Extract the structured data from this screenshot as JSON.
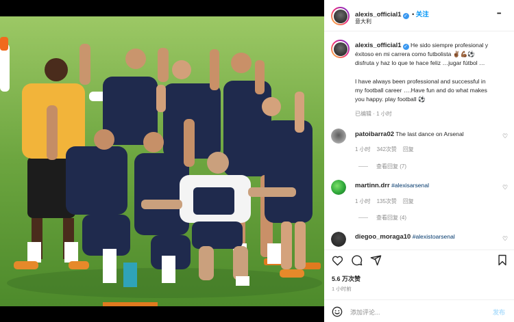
{
  "post": {
    "username": "alexis_official1",
    "follow_label": "关注",
    "location": "意大利",
    "more_label": "•••",
    "caption_user": "alexis_official1",
    "caption_text": "He sido siempre profesional y éxitoso en mi carrera como futbolista ✌🏾💪🏾⚽ disfruta y haz lo que te hace feliz …jugar fútbol … I have always been professional and successful in my football career ….Have fun and do what makes you happy. play football ⚽",
    "caption_line1": "He sido siempre profesional y",
    "caption_line2": "éxitoso en mi carrera como futbolista ✌🏾💪🏾⚽",
    "caption_line3": "disfruta y haz lo que te hace feliz …jugar fútbol …",
    "caption_line4": "I have always been professional and successful in",
    "caption_line5": "my football career ….Have fun and do what makes",
    "caption_line6": "you happy. play football ⚽",
    "edited_label": "已编辑 · 1 小时"
  },
  "comments": [
    {
      "username": "patoibarra02",
      "text": "The last dance on Arsenal",
      "time": "1 小时",
      "likes": "342次赞",
      "reply": "回复",
      "view_replies": "查看回复 (7)"
    },
    {
      "username": "martinn.drr",
      "text": "#alexisarsenal",
      "time": "1 小时",
      "likes": "135次赞",
      "reply": "回复",
      "view_replies": "查看回复 (4)"
    },
    {
      "username": "diegoo_moraga10",
      "text": "#alexistoarsenal"
    }
  ],
  "stats": {
    "likes": "5.6 万次赞",
    "time": "1 小时前"
  },
  "add_comment": {
    "placeholder": "添加评论...",
    "post_label": "发布"
  },
  "colors": {
    "accent": "#0095f6",
    "verified": "#3897f0",
    "hashtag": "#00376b"
  },
  "icons": [
    "heart-icon",
    "comment-icon",
    "share-icon",
    "bookmark-icon",
    "emoji-icon",
    "verified-badge-icon",
    "more-icon"
  ]
}
